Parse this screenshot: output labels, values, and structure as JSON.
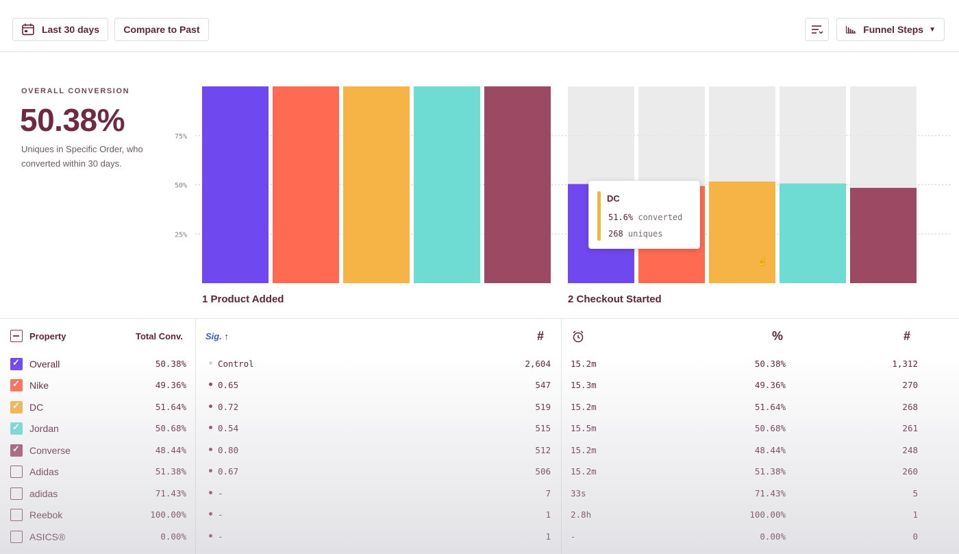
{
  "toolbar": {
    "date_range_label": "Last 30 days",
    "compare_label": "Compare to Past",
    "view_mode_label": "Funnel Steps"
  },
  "overall": {
    "label": "OVERALL CONVERSION",
    "value": "50.38%",
    "description": "Uniques in Specific Order, who converted within 30 days."
  },
  "chart_data": {
    "type": "bar",
    "y_ticks": [
      "75%",
      "50%",
      "25%"
    ],
    "steps": [
      {
        "label": "1 Product Added",
        "values": [
          100,
          100,
          100,
          100,
          100
        ]
      },
      {
        "label": "2 Checkout Started",
        "values": [
          50.38,
          49.36,
          51.64,
          50.68,
          48.44
        ]
      }
    ],
    "series": [
      {
        "name": "Overall",
        "color": "#7048f0"
      },
      {
        "name": "Nike",
        "color": "#ff6b52"
      },
      {
        "name": "DC",
        "color": "#f6b346"
      },
      {
        "name": "Jordan",
        "color": "#6edcd2"
      },
      {
        "name": "Converse",
        "color": "#9c4a63"
      }
    ],
    "ylim": [
      0,
      100
    ]
  },
  "tooltip": {
    "title": "DC",
    "converted_value": "51.6%",
    "converted_label": "converted",
    "uniques_value": "268",
    "uniques_label": "uniques"
  },
  "table": {
    "headers": {
      "property": "Property",
      "total_conv": "Total Conv.",
      "sig": "Sig.",
      "sig_arrow": "↑",
      "count": "#",
      "pct": "%",
      "count2": "#"
    },
    "rows": [
      {
        "name": "Overall",
        "total": "50.38%",
        "sig": "Control",
        "count": "2,604",
        "time": "15.2m",
        "pct": "50.38%",
        "count2": "1,312",
        "checked": true,
        "color": "#7048f0"
      },
      {
        "name": "Nike",
        "total": "49.36%",
        "sig": "0.65",
        "count": "547",
        "time": "15.3m",
        "pct": "49.36%",
        "count2": "270",
        "checked": true,
        "color": "#ff6b52"
      },
      {
        "name": "DC",
        "total": "51.64%",
        "sig": "0.72",
        "count": "519",
        "time": "15.2m",
        "pct": "51.64%",
        "count2": "268",
        "checked": true,
        "color": "#f6b346"
      },
      {
        "name": "Jordan",
        "total": "50.68%",
        "sig": "0.54",
        "count": "515",
        "time": "15.5m",
        "pct": "50.68%",
        "count2": "261",
        "checked": true,
        "color": "#6edcd2"
      },
      {
        "name": "Converse",
        "total": "48.44%",
        "sig": "0.80",
        "count": "512",
        "time": "15.2m",
        "pct": "48.44%",
        "count2": "248",
        "checked": true,
        "color": "#9c4a63"
      },
      {
        "name": "Adidas",
        "total": "51.38%",
        "sig": "0.67",
        "count": "506",
        "time": "15.2m",
        "pct": "51.38%",
        "count2": "260",
        "checked": false,
        "color": ""
      },
      {
        "name": "adidas",
        "total": "71.43%",
        "sig": "-",
        "count": "7",
        "time": "33s",
        "pct": "71.43%",
        "count2": "5",
        "checked": false,
        "color": ""
      },
      {
        "name": "Reebok",
        "total": "100.00%",
        "sig": "-",
        "count": "1",
        "time": "2.8h",
        "pct": "100.00%",
        "count2": "1",
        "checked": false,
        "color": ""
      },
      {
        "name": "ASICS®",
        "total": "0.00%",
        "sig": "-",
        "count": "1",
        "time": "-",
        "pct": "0.00%",
        "count2": "0",
        "checked": false,
        "color": ""
      }
    ]
  }
}
